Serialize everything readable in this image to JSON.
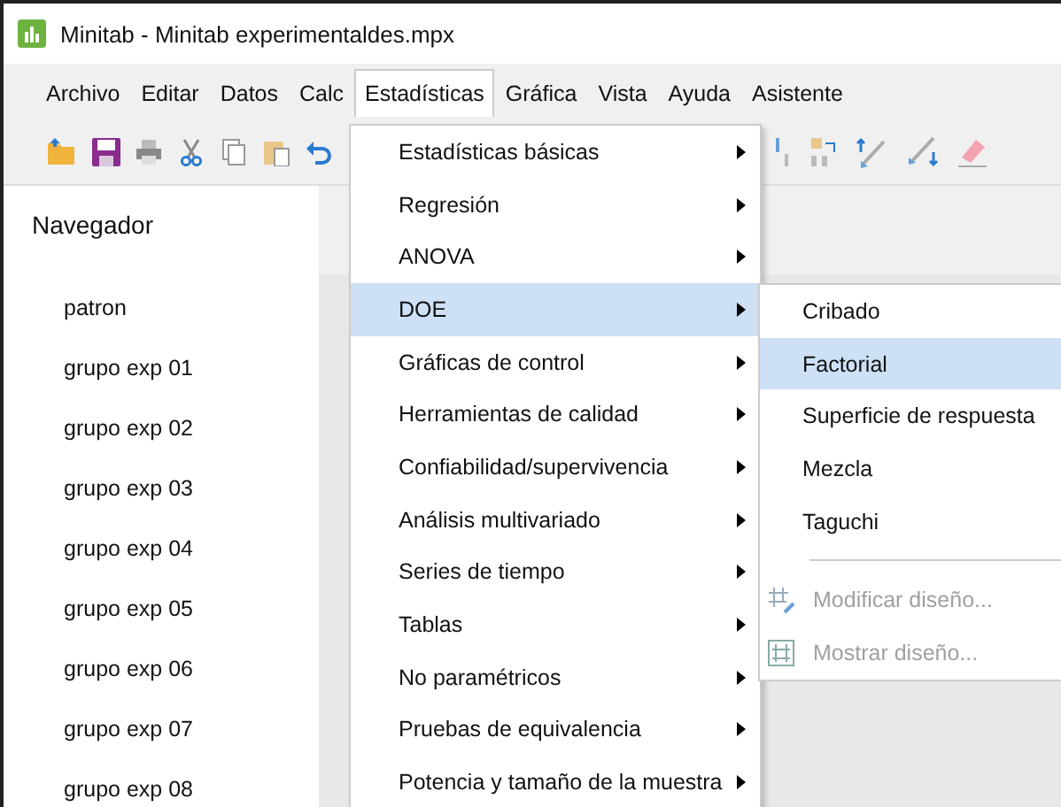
{
  "window": {
    "title": "Minitab - Minitab experimentaldes.mpx"
  },
  "menubar": [
    {
      "label": "Archivo",
      "selected": false
    },
    {
      "label": "Editar",
      "selected": false
    },
    {
      "label": "Datos",
      "selected": false
    },
    {
      "label": "Calc",
      "selected": false
    },
    {
      "label": "Estadísticas",
      "selected": true
    },
    {
      "label": "Gráfica",
      "selected": false
    },
    {
      "label": "Vista",
      "selected": false
    },
    {
      "label": "Ayuda",
      "selected": false
    },
    {
      "label": "Asistente",
      "selected": false
    }
  ],
  "navigator": {
    "title": "Navegador",
    "items": [
      "patron",
      "grupo exp 01",
      "grupo exp 02",
      "grupo exp 03",
      "grupo exp 04",
      "grupo exp 05",
      "grupo exp 06",
      "grupo exp 07",
      "grupo exp 08"
    ]
  },
  "menu": [
    {
      "label": "Estadísticas básicas",
      "selected": false
    },
    {
      "label": "Regresión",
      "selected": false
    },
    {
      "label": "ANOVA",
      "selected": false
    },
    {
      "label": "DOE",
      "selected": true
    },
    {
      "label": "Gráficas de control",
      "selected": false
    },
    {
      "label": "Herramientas de calidad",
      "selected": false
    },
    {
      "label": "Confiabilidad/supervivencia",
      "selected": false
    },
    {
      "label": "Análisis multivariado",
      "selected": false
    },
    {
      "label": "Series de tiempo",
      "selected": false
    },
    {
      "label": "Tablas",
      "selected": false
    },
    {
      "label": "No paramétricos",
      "selected": false
    },
    {
      "label": "Pruebas de equivalencia",
      "selected": false
    },
    {
      "label": "Potencia y tamaño de la muestra",
      "selected": false
    }
  ],
  "submenu": [
    {
      "kind": "item",
      "label": "Cribado",
      "selected": false,
      "disabled": false
    },
    {
      "kind": "item",
      "label": "Factorial",
      "selected": true,
      "disabled": false
    },
    {
      "kind": "item",
      "label": "Superficie de respuesta",
      "selected": false,
      "disabled": false
    },
    {
      "kind": "item",
      "label": "Mezcla",
      "selected": false,
      "disabled": false
    },
    {
      "kind": "item",
      "label": "Taguchi",
      "selected": false,
      "disabled": false
    },
    {
      "kind": "separator"
    },
    {
      "kind": "action",
      "label": "Modificar diseño...",
      "disabled": true
    },
    {
      "kind": "action",
      "label": "Mostrar diseño...",
      "disabled": true
    }
  ]
}
